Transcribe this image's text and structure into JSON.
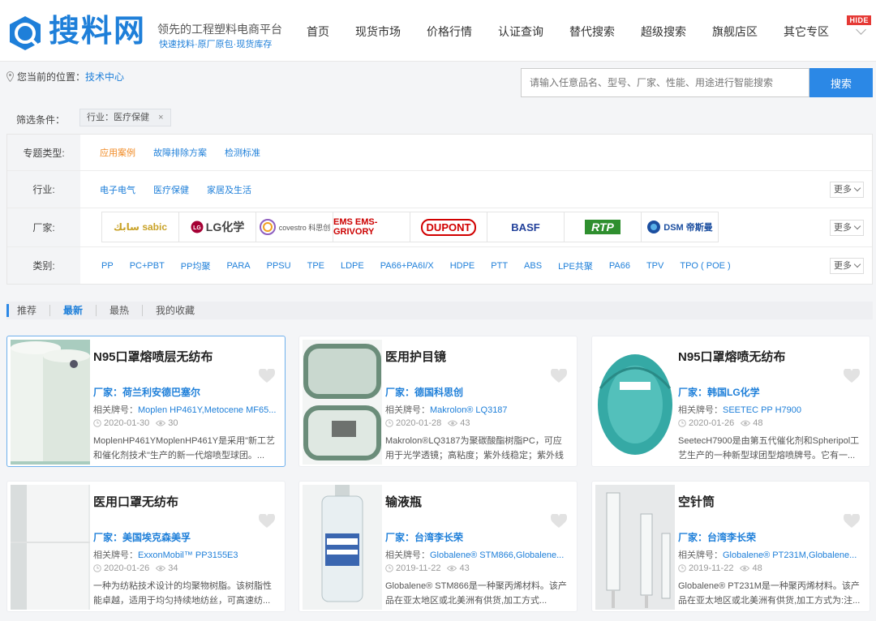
{
  "header": {
    "brand": "搜料网",
    "slogan": "领先的工程塑料电商平台",
    "subslogan": "快速找料·原厂原包·现货库存",
    "nav": [
      "首页",
      "现货市场",
      "价格行情",
      "认证查询",
      "替代搜索",
      "超级搜索",
      "旗舰店区",
      "其它专区"
    ],
    "hide_badge": "HIDE"
  },
  "breadcrumb": {
    "label": "您当前的位置：",
    "link": "技术中心"
  },
  "search": {
    "placeholder": "请输入任意品名、型号、厂家、性能、用途进行智能搜索",
    "button": "搜索"
  },
  "filter": {
    "label": "筛选条件：",
    "tag": "行业：医疗保健",
    "tag_close": "×"
  },
  "filter_rows": {
    "topic": {
      "label": "专题类型:",
      "options": [
        "应用案例",
        "故障排除方案",
        "检测标准"
      ]
    },
    "industry": {
      "label": "行业:",
      "options": [
        "电子电气",
        "医疗保健",
        "家居及生活"
      ],
      "more": "更多"
    },
    "maker": {
      "label": "厂家:",
      "more": "更多",
      "brands": [
        "سابك sabic",
        "LG化学",
        "covestro 科思创",
        "EMS EMS-GRIVORY",
        "DUPONT",
        "BASF",
        "RTP",
        "DSM 帝斯曼"
      ]
    },
    "category": {
      "label": "类别:",
      "more": "更多",
      "options": [
        "PP",
        "PC+PBT",
        "PP均聚",
        "PARA",
        "PPSU",
        "TPE",
        "LDPE",
        "PA66+PA6I/X",
        "HDPE",
        "PTT",
        "ABS",
        "LPE共聚",
        "PA66",
        "TPV",
        "TPO ( POE )"
      ]
    }
  },
  "tabs": [
    "推荐",
    "最新",
    "最热",
    "我的收藏"
  ],
  "grade_prefix": "相关牌号：",
  "cards": [
    {
      "title": "N95口罩熔喷层无纺布",
      "maker": "厂家：荷兰利安德巴塞尔",
      "grade": "Moplen HP461Y,Metocene MF65...",
      "date": "2020-01-30",
      "views": "30",
      "desc": "MoplenHP461YMoplenHP461Y是采用\"新工艺和催化剂技术\"生产的新一代熔喷型球团。..."
    },
    {
      "title": "医用护目镜",
      "maker": "厂家：德国科思创",
      "grade": "Makrolon® LQ3187",
      "date": "2020-01-28",
      "views": "43",
      "desc": "Makrolon®LQ3187为聚碳酸酯树脂PC，可应用于光学透镜；高粘度；紫外线稳定；紫外线4..."
    },
    {
      "title": "N95口罩熔喷无纺布",
      "maker": "厂家：韩国LG化学",
      "grade": "SEETEC PP H7900",
      "date": "2020-01-26",
      "views": "48",
      "desc": "SeetecH7900是由第五代催化剂和Spheripol工艺生产的一种新型球团型熔喷牌号。它有一..."
    },
    {
      "title": "医用口罩无纺布",
      "maker": "厂家：美国埃克森美孚",
      "grade": "ExxonMobil™ PP3155E3",
      "date": "2020-01-26",
      "views": "34",
      "desc": "一种为纺粘技术设计的均聚物树脂。该树脂性能卓越，适用于均匀持续地纺丝，可高速纺..."
    },
    {
      "title": "输液瓶",
      "maker": "厂家：台湾李长荣",
      "grade": "Globalene® STM866,Globalene...",
      "date": "2019-11-22",
      "views": "43",
      "desc": "Globalene® STM866是一种聚丙烯材料。该产品在亚太地区或北美洲有供货,加工方式..."
    },
    {
      "title": "空针筒",
      "maker": "厂家：台湾李长荣",
      "grade": "Globalene® PT231M,Globalene...",
      "date": "2019-11-22",
      "views": "48",
      "desc": "Globalene® PT231M是一种聚丙烯材料。该产品在亚太地区或北美洲有供货,加工方式为:注..."
    }
  ],
  "colors": {
    "brand_blue": "#1e7fd9",
    "button_blue": "#2b88e6",
    "active_orange": "#f08a24",
    "badge_red": "#e53935"
  }
}
